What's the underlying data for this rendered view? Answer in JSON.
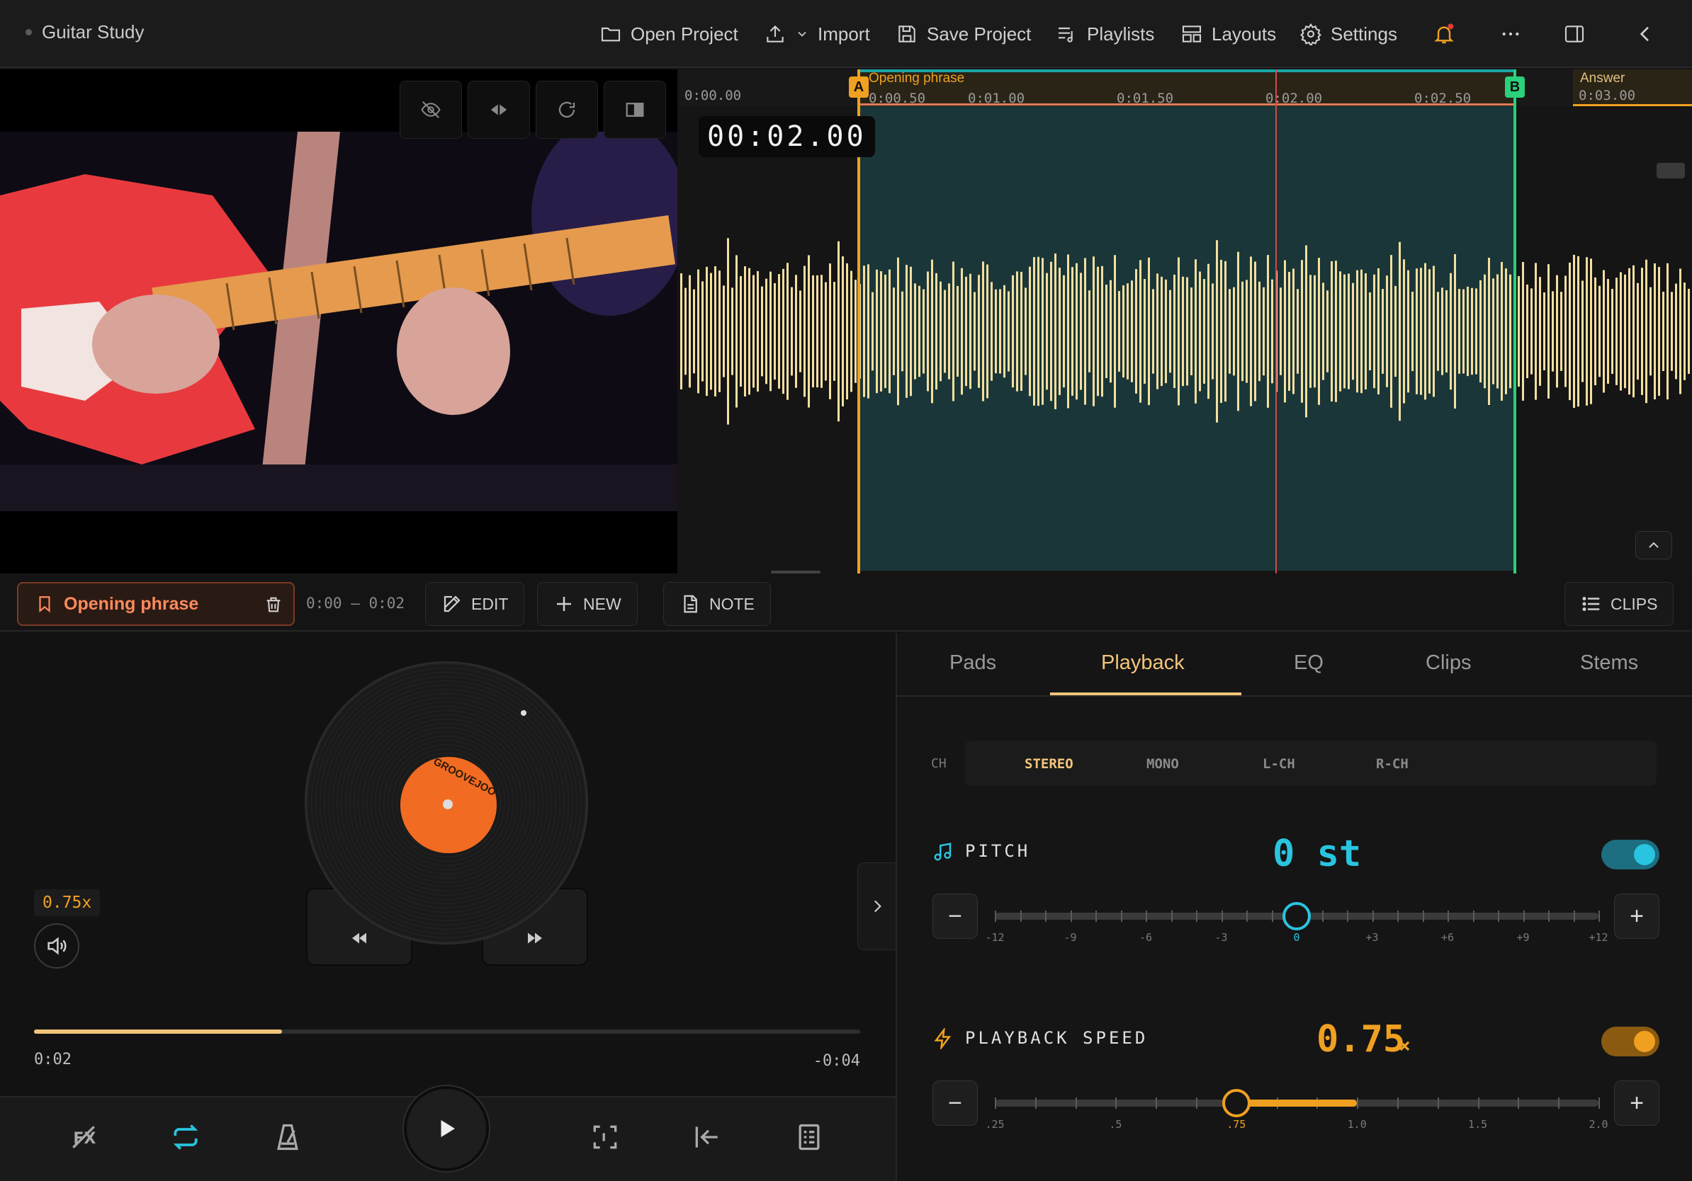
{
  "topbar": {
    "title": "Guitar Study",
    "open_project": "Open Project",
    "import": "Import",
    "save_project": "Save Project",
    "playlists": "Playlists",
    "layouts": "Layouts",
    "settings": "Settings"
  },
  "waveform": {
    "timecode": "00:02.00",
    "ruler_labels": [
      "0:00.00",
      "0:00.50",
      "0:01.00",
      "0:01.50",
      "0:02.00",
      "0:02.50",
      "0:03.00"
    ],
    "region_name": "Opening phrase",
    "next_region_name": "Answer",
    "marker_a": "A",
    "marker_b": "B",
    "wave_color": "#f5dfa0"
  },
  "section_bar": {
    "section_name": "Opening phrase",
    "range": "0:00 – 0:02",
    "edit": "EDIT",
    "new": "NEW",
    "note": "NOTE",
    "clips": "CLIPS"
  },
  "player": {
    "speed_badge": "0.75x",
    "record_brand": "GROOVEJOO",
    "elapsed": "0:02",
    "remaining": "-0:04",
    "progress": 0.3
  },
  "tabs": [
    "Pads",
    "Playback",
    "EQ",
    "Clips",
    "Stems"
  ],
  "active_tab": "Playback",
  "channel": {
    "label": "CH",
    "options": [
      "STEREO",
      "MONO",
      "L-CH",
      "R-CH"
    ],
    "selected": "STEREO"
  },
  "pitch": {
    "title": "PITCH",
    "value": "0 st",
    "enabled": true,
    "accent": "#29c4e0",
    "scale": [
      "-12",
      "-9",
      "-6",
      "-3",
      "0",
      "+3",
      "+6",
      "+9",
      "+12"
    ],
    "current": 0
  },
  "speed": {
    "title": "PLAYBACK SPEED",
    "value": "0.75",
    "unit": "×",
    "enabled": true,
    "accent": "#f0a020",
    "scale": [
      ".25",
      ".5",
      ".75",
      "1.0",
      "1.5",
      "2.0"
    ],
    "current": 0.75
  }
}
